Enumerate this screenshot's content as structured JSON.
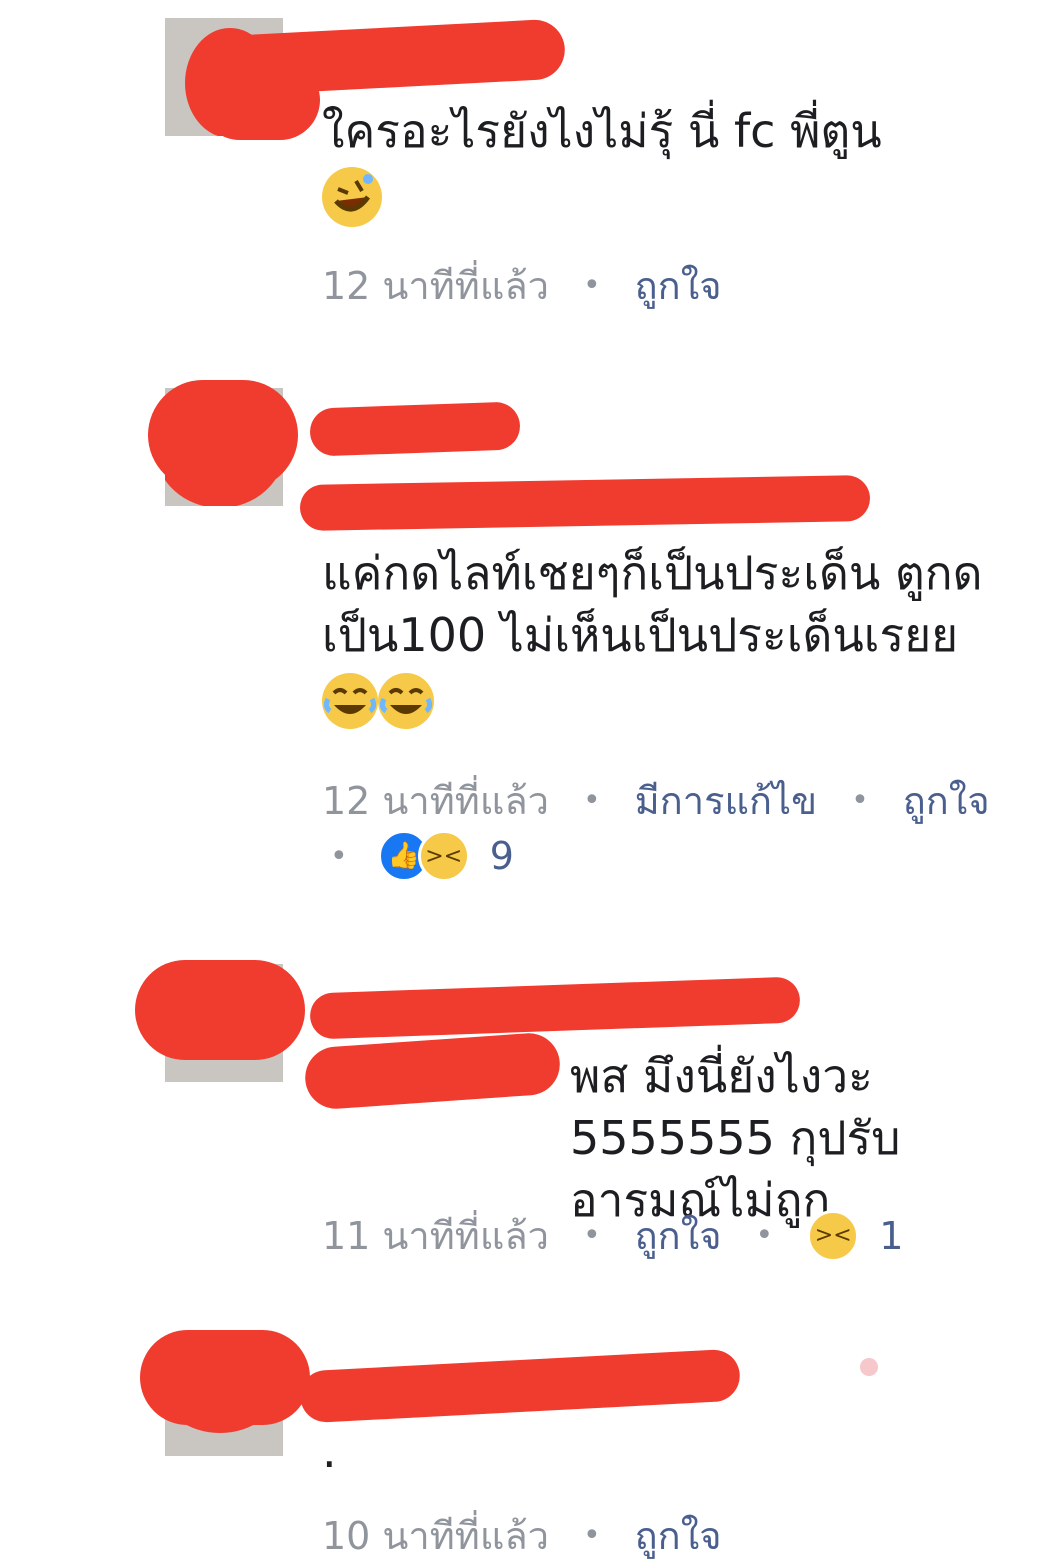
{
  "comments": [
    {
      "text": "ใครอะไรยังไงไม่รุ้ นี่ fc พี่ตูน",
      "emoji": "rolling-on-floor-laughing",
      "time": "12 นาทีที่แล้ว",
      "like_action": "ถูกใจ"
    },
    {
      "text": "แค่กดไลท์เชยๆก็เป็นประเด็น ตูกดเป็น100 ไม่เห็นเป็นประเด็นเรยย",
      "emoji": "joy-joy",
      "time": "12 นาทีที่แล้ว",
      "edited": "มีการแก้ไข",
      "like_action": "ถูกใจ",
      "reaction_count": "9"
    },
    {
      "text": "พส มึงนี่ยังไงวะ 5555555 กุปรับอารมณ์ไม่ถูก",
      "time": "11 นาทีที่แล้ว",
      "like_action": "ถูกใจ",
      "reaction_count": "1"
    },
    {
      "text": ".",
      "time": "10 นาทีที่แล้ว",
      "like_action": "ถูกใจ"
    }
  ],
  "colors": {
    "redaction": "#f03b2f",
    "meta_gray": "#90949c",
    "link_blue": "#4b5f8f",
    "like_blue": "#1877f2",
    "emoji_yellow": "#f7c948"
  }
}
